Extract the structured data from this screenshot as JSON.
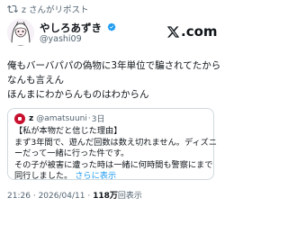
{
  "repost": {
    "text": "z さんがリポスト",
    "icon": "repost-icon"
  },
  "author": {
    "display_name": "やしろあずき",
    "verified": true,
    "verified_color": "#1d9bf0",
    "handle": "@yashi09",
    "avatar_icon": "avatar-illustration"
  },
  "brand": {
    "logo_text": ".com",
    "icon": "x-logo-icon"
  },
  "tweet": {
    "lines": [
      "俺もバーバパパの偽物に3年単位で騙されてたから",
      "なんも言えん",
      "ほんまにわからんものはわからん"
    ]
  },
  "quote": {
    "name": "z",
    "handle": "@amatsuuni",
    "separator": "·",
    "time": "3日",
    "lines": [
      "【私が本物だと信じた理由】",
      "まず3年間で、遊んだ回数は数え切れません。ディズニ",
      "ーだって一緒に行った件です。",
      "その子が被害に遭った時は一緒に何時間も警察にまで"
    ],
    "last_line": "同行しました。",
    "show_more": "さらに表示",
    "avatar_color": "#c8102e"
  },
  "meta": {
    "time": "21:26",
    "date": "2026/04/11",
    "separator": "·",
    "views_count": "118万",
    "views_label": "回表示"
  },
  "colors": {
    "text": "#0f1419",
    "secondary": "#536471",
    "link": "#1d9bf0",
    "border": "#cfd9de"
  }
}
